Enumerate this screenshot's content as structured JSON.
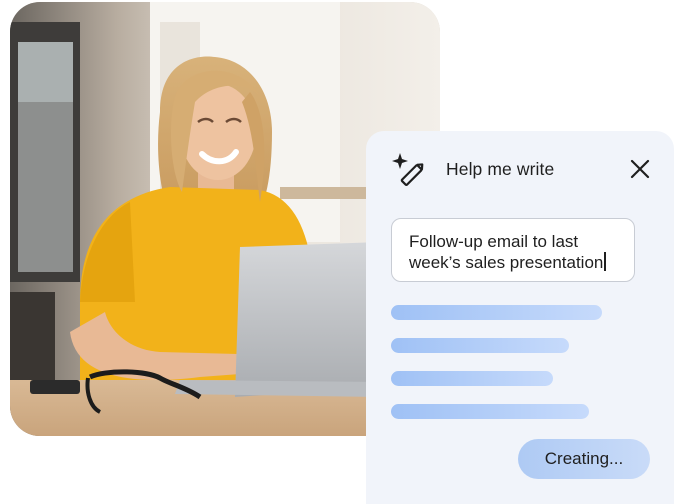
{
  "panel": {
    "title": "Help me write",
    "prompt_text": "Follow-up email to last\nweek’s sales presentation",
    "status_button_label": "Creating..."
  },
  "icons": {
    "title_icon": "sparkle-pencil-icon",
    "close_icon": "close-icon"
  },
  "colors": {
    "panel_background": "#f1f4fa",
    "skeleton_start": "#9fc1f5",
    "skeleton_end": "#c6dafb",
    "shirt": "#f2b21a",
    "text": "#1f1f1f"
  }
}
